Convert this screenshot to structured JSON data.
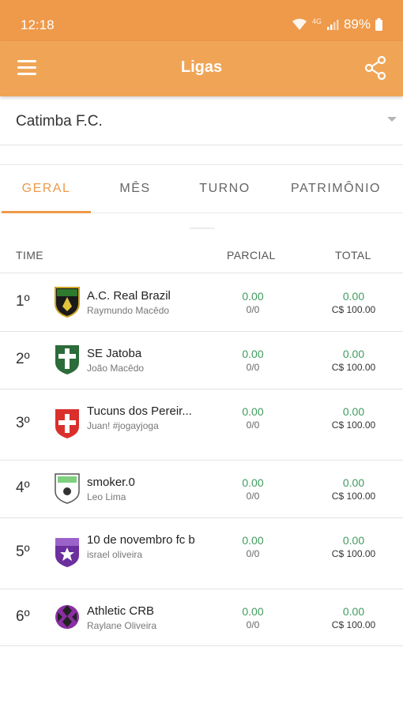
{
  "status_bar": {
    "time": "12:18",
    "network": "4G",
    "battery": "89%"
  },
  "app_bar": {
    "title": "Ligas",
    "menu_icon": "menu-icon",
    "share_icon": "share-icon"
  },
  "team_selector": {
    "value": "Catimba F.C."
  },
  "tabs": [
    {
      "label": "GERAL",
      "active": true
    },
    {
      "label": "MÊS",
      "active": false
    },
    {
      "label": "TURNO",
      "active": false
    },
    {
      "label": "PATRIMÔNIO",
      "active": false
    }
  ],
  "table": {
    "headers": {
      "time": "TIME",
      "parcial": "PARCIAL",
      "total": "TOTAL"
    },
    "rows": [
      {
        "position": "1º",
        "team": "A.C. Real Brazil",
        "owner": "Raymundo Macêdo",
        "parcial": "0.00",
        "parcial_sub": "0/0",
        "total": "0.00",
        "total_sub": "C$ 100.00"
      },
      {
        "position": "2º",
        "team": "SE Jatoba",
        "owner": "João Macêdo",
        "parcial": "0.00",
        "parcial_sub": "0/0",
        "total": "0.00",
        "total_sub": "C$ 100.00"
      },
      {
        "position": "3º",
        "team": "Tucuns dos Pereir...",
        "owner": "Juan! #jogayjoga",
        "parcial": "0.00",
        "parcial_sub": "0/0",
        "total": "0.00",
        "total_sub": "C$ 100.00"
      },
      {
        "position": "4º",
        "team": "smoker.0",
        "owner": "Leo Lima",
        "parcial": "0.00",
        "parcial_sub": "0/0",
        "total": "0.00",
        "total_sub": "C$ 100.00"
      },
      {
        "position": "5º",
        "team": "10 de novembro fc b",
        "owner": "israel oliveira",
        "parcial": "0.00",
        "parcial_sub": "0/0",
        "total": "0.00",
        "total_sub": "C$ 100.00"
      },
      {
        "position": "6º",
        "team": "Athletic CRB",
        "owner": "Raylane Oliveira",
        "parcial": "0.00",
        "parcial_sub": "0/0",
        "total": "0.00",
        "total_sub": "C$ 100.00"
      }
    ]
  },
  "colors": {
    "accent": "#ee9a4a",
    "appbar": "#f0a556",
    "score_green": "#3f9b5e"
  }
}
